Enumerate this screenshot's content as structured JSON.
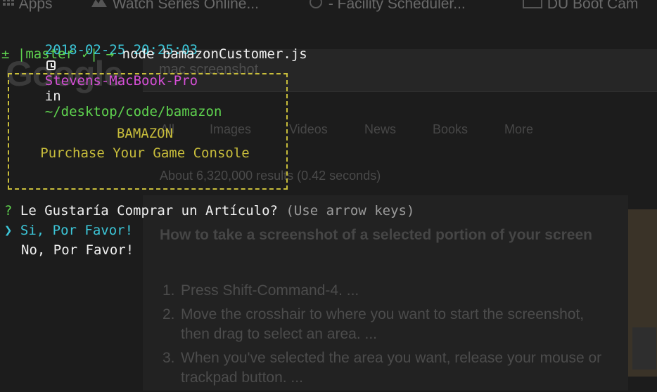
{
  "browser_bg": {
    "bookmarks": [
      {
        "label": "Apps",
        "icon": "apps-grid-icon"
      },
      {
        "label": "Watch Series Online...",
        "icon": "bookmark-icon"
      },
      {
        "label": "- Facility Scheduler...",
        "icon": "globe-icon"
      },
      {
        "label": "DU Boot Cam",
        "icon": "folder-icon"
      }
    ],
    "logo_text": "Google",
    "search_query": "mac screenshot",
    "tabs": [
      "All",
      "Images",
      "Videos",
      "News",
      "Books",
      "More"
    ],
    "result_stats": "About 6,320,000 results (0.42 seconds)",
    "result_title": "How to take a screenshot of a selected portion of your screen",
    "steps": [
      {
        "num": "1.",
        "text": "Press Shift-Command-4. ..."
      },
      {
        "num": "2.",
        "text": "Move the crosshair to where you want to start the screenshot, then drag to select an area. ..."
      },
      {
        "num": "3.",
        "text": "When you've selected the area you want, release your mouse or trackpad button. ..."
      }
    ]
  },
  "terminal": {
    "prompt": {
      "datetime": "2018-02-25 20:25:03",
      "clock_icon": "clock-icon",
      "host": "Stevens-MacBook-Pro",
      "in_word": "in",
      "path": "~/desktop/code/bamazon"
    },
    "git_line": {
      "prefix": "± |master ✓|",
      "arrow": "→",
      "command": "node bamazonCustomer.js"
    },
    "banner": {
      "title": "BAMAZON",
      "subtitle": "Purchase Your Game Console"
    },
    "question": {
      "mark": "?",
      "text": "Le Gustaría Comprar un Artículo?",
      "hint": "(Use arrow keys)"
    },
    "choices": [
      {
        "pointer": "❯",
        "label": "Si, Por Favor!",
        "selected": true
      },
      {
        "pointer": "",
        "label": "No, Por Favor!",
        "selected": false
      }
    ]
  },
  "colors": {
    "background": "#1c1c1c",
    "cyan": "#3cc6d8",
    "magenta": "#d54fd6",
    "green": "#5fd34f",
    "yellow": "#c8bd3b"
  }
}
